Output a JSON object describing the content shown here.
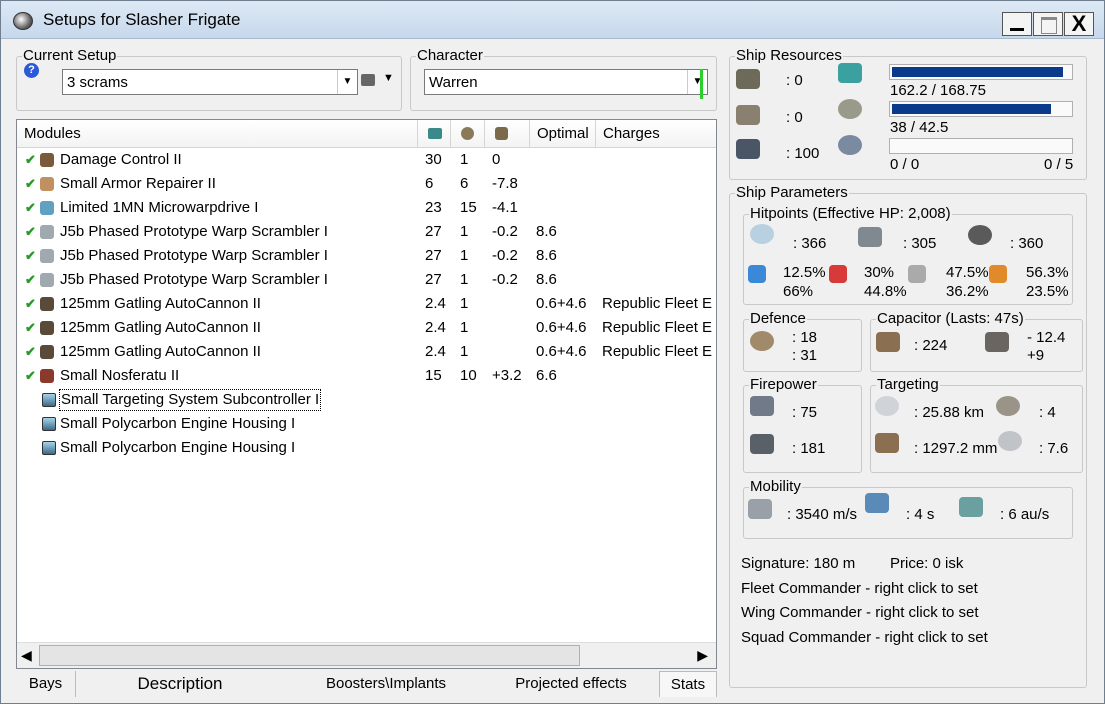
{
  "window": {
    "title": "Setups for Slasher Frigate",
    "close_glyph": "X"
  },
  "current_setup": {
    "label": "Current Setup",
    "value": "3 scrams"
  },
  "character": {
    "label": "Character",
    "value": "Warren"
  },
  "modules": {
    "columns": [
      "Modules",
      "",
      "",
      "",
      "Optimal",
      "Charges"
    ],
    "rows": [
      {
        "check": "✔",
        "name": "Damage Control II",
        "cpu": "30",
        "pg": "1",
        "cap": "0",
        "optimal": "",
        "charges": ""
      },
      {
        "check": "✔",
        "name": "Small Armor Repairer II",
        "cpu": "6",
        "pg": "6",
        "cap": "-7.8",
        "optimal": "",
        "charges": ""
      },
      {
        "check": "✔",
        "name": "Limited 1MN Microwarpdrive I",
        "cpu": "23",
        "pg": "15",
        "cap": "-4.1",
        "optimal": "",
        "charges": ""
      },
      {
        "check": "✔",
        "name": "J5b Phased Prototype Warp Scrambler I",
        "cpu": "27",
        "pg": "1",
        "cap": "-0.2",
        "optimal": "8.6",
        "charges": ""
      },
      {
        "check": "✔",
        "name": "J5b Phased Prototype Warp Scrambler I",
        "cpu": "27",
        "pg": "1",
        "cap": "-0.2",
        "optimal": "8.6",
        "charges": ""
      },
      {
        "check": "✔",
        "name": "J5b Phased Prototype Warp Scrambler I",
        "cpu": "27",
        "pg": "1",
        "cap": "-0.2",
        "optimal": "8.6",
        "charges": ""
      },
      {
        "check": "✔",
        "name": "125mm Gatling AutoCannon II",
        "cpu": "2.4",
        "pg": "1",
        "cap": "",
        "optimal": "0.6+4.6",
        "charges": "Republic Fleet E"
      },
      {
        "check": "✔",
        "name": "125mm Gatling AutoCannon II",
        "cpu": "2.4",
        "pg": "1",
        "cap": "",
        "optimal": "0.6+4.6",
        "charges": "Republic Fleet E"
      },
      {
        "check": "✔",
        "name": "125mm Gatling AutoCannon II",
        "cpu": "2.4",
        "pg": "1",
        "cap": "",
        "optimal": "0.6+4.6",
        "charges": "Republic Fleet E"
      },
      {
        "check": "✔",
        "name": "Small Nosferatu II",
        "cpu": "15",
        "pg": "10",
        "cap": "+3.2",
        "optimal": "6.6",
        "charges": ""
      },
      {
        "check": "",
        "name": "Small Targeting System Subcontroller I",
        "cpu": "",
        "pg": "",
        "cap": "",
        "optimal": "",
        "charges": ""
      },
      {
        "check": "",
        "name": "Small Polycarbon Engine Housing I",
        "cpu": "",
        "pg": "",
        "cap": "",
        "optimal": "",
        "charges": ""
      },
      {
        "check": "",
        "name": "Small Polycarbon Engine Housing I",
        "cpu": "",
        "pg": "",
        "cap": "",
        "optimal": "",
        "charges": ""
      }
    ]
  },
  "tabs": [
    "Bays",
    "Description",
    "Boosters\\Implants",
    "Projected effects",
    "Stats"
  ],
  "ship_resources": {
    "label": "Ship Resources",
    "turrets": ": 0",
    "launchers": ": 0",
    "calibration": ": 100",
    "cpu_text": "162.2 / 168.75",
    "cpu_fraction": 0.961,
    "pg_text": "38 / 42.5",
    "pg_fraction": 0.894,
    "drone_bw_text": "0 / 0",
    "drone_bay_text": "0 / 5",
    "drone_fraction": 0
  },
  "ship_parameters": {
    "label": "Ship Parameters",
    "hitpoints": {
      "label": "Hitpoints (Effective HP: 2,008)",
      "shield": ": 366",
      "armor": ": 305",
      "structure": ": 360",
      "res": [
        {
          "top": "12.5%",
          "bottom": "66%"
        },
        {
          "top": "30%",
          "bottom": "44.8%"
        },
        {
          "top": "47.5%",
          "bottom": "36.2%"
        },
        {
          "top": "56.3%",
          "bottom": "23.5%"
        }
      ]
    },
    "defence": {
      "label": "Defence",
      "a": ": 18",
      "b": ": 31"
    },
    "capacitor": {
      "label": "Capacitor (Lasts: 47s)",
      "amount": ": 224",
      "delta_top": "- 12.4",
      "delta_bottom": "+9"
    },
    "firepower": {
      "label": "Firepower",
      "volley": ": 75",
      "dps": ": 181"
    },
    "targeting": {
      "label": "Targeting",
      "range": ": 25.88 km",
      "targets": ": 4",
      "scan_res": ": 1297.2 mm",
      "sensor": ": 7.6"
    },
    "mobility": {
      "label": "Mobility",
      "speed": ": 3540 m/s",
      "align": ": 4 s",
      "warp": ": 6 au/s"
    },
    "signature": "Signature: 180 m",
    "price": "Price: 0 isk",
    "fleet": "Fleet Commander - right click to set",
    "wing": "Wing Commander - right click to set",
    "squad": "Squad Commander - right click to set"
  }
}
